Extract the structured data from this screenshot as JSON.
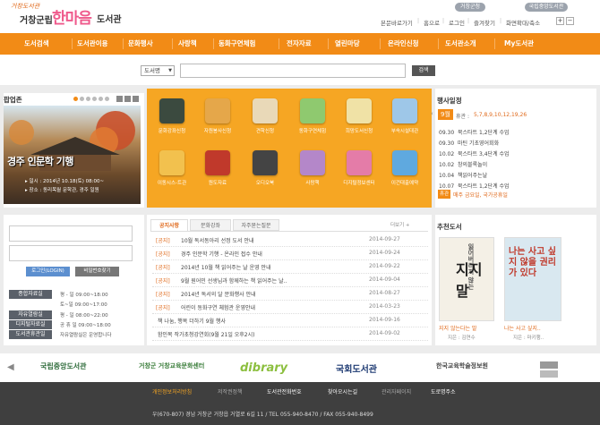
{
  "header": {
    "logo_small": "거창도서관",
    "logo_city": "거창군립",
    "logo_main": "한마음",
    "logo_lib": "도서관",
    "top_pills": [
      "거창군청",
      "국립중앙도서관"
    ],
    "util_links": [
      "본문바로가기",
      "홈으로",
      "로그인",
      "즐겨찾기",
      "화면확대/축소"
    ]
  },
  "nav": {
    "items": [
      "도서검색",
      "도서관이용",
      "문화행사",
      "사랑책",
      "동화구연체험",
      "전자자료",
      "열린마당",
      "온라인신청",
      "도서관소개",
      "My도서관"
    ]
  },
  "search": {
    "select_value": "도서명",
    "input_value": "",
    "button_label": "검색"
  },
  "popup": {
    "title": "팝업존",
    "headline": "경주 인문학 기행",
    "line1": "▸ 일시 : 2014년 10.18(토) 08:00~",
    "line2": "▸ 장소 : 동리목월 문학관, 경주 일원"
  },
  "services": [
    {
      "label": "문화강좌신청",
      "icon": "blackboard-icon",
      "color": "#3b4a3f"
    },
    {
      "label": "자원봉사신청",
      "icon": "books-shelf-icon",
      "color": "#e5a74a"
    },
    {
      "label": "견학신청",
      "icon": "hands-icon",
      "color": "#e9d9b8"
    },
    {
      "label": "동화구연체험",
      "icon": "storybook-icon",
      "color": "#8fc96f"
    },
    {
      "label": "희망도서신청",
      "icon": "notepad-icon",
      "color": "#f0e2a6"
    },
    {
      "label": "부속시설대관",
      "icon": "blocks-icon",
      "color": "#9ec7e8"
    },
    {
      "label": "이동시스-트관",
      "icon": "house-icon",
      "color": "#f2c14e"
    },
    {
      "label": "원도자료",
      "icon": "binders-icon",
      "color": "#c0392b"
    },
    {
      "label": "오디오북",
      "icon": "headphones-icon",
      "color": "#444444"
    },
    {
      "label": "사랑책",
      "icon": "family-icon",
      "color": "#b487c9"
    },
    {
      "label": "디지털정보센터",
      "icon": "cube-icon",
      "color": "#e47ca8"
    },
    {
      "label": "이건대출예약",
      "icon": "globe-icon",
      "color": "#5fa9df"
    }
  ],
  "events": {
    "title": "행사일정",
    "month": "9월",
    "label": "휴관 :",
    "days": "5,7,8,9,10,12,19,26",
    "items": [
      {
        "time": "09.30",
        "text": "북스타트 1,2단계 수업"
      },
      {
        "time": "09.30",
        "text": "마틴 기초영어회화"
      },
      {
        "time": "10.02",
        "text": "북스타트 3,4단계 수업"
      },
      {
        "time": "10.02",
        "text": "창의블록놀이"
      },
      {
        "time": "10.04",
        "text": "책읽어주는날"
      },
      {
        "time": "10.07",
        "text": "북스타트 1,2단계 수업"
      }
    ],
    "closed_badge": "휴관",
    "closed_text": "매주 금요일, 국가공휴일"
  },
  "login": {
    "login_label": "로그인(LOGIN)",
    "signup_label": "비밀번호찾기",
    "hours": [
      {
        "label": "종합자료실",
        "lines": [
          "평 - 일 09:00~18:00",
          "토~일 09:00~17:00"
        ]
      },
      {
        "label": "자유열람실",
        "lines": [
          "평 - 일 08:00~22:00"
        ]
      },
      {
        "label": "디지털자료실",
        "lines": [
          "공 휴 일 09:00~18:00"
        ]
      },
      {
        "label": "도서관휴관일",
        "lines": [
          "자유열람실은 운영합니다"
        ]
      }
    ]
  },
  "notices": {
    "tabs": [
      "공지사항",
      "문화강좌",
      "자주묻는질문"
    ],
    "more": "더보기 +",
    "rows": [
      {
        "cat": "[공지]",
        "title": "10월 독서동아리 선정 도서 안내",
        "date": "2014-09-27"
      },
      {
        "cat": "[공지]",
        "title": "경주 인문학 기행 - 온라인 접수 안내",
        "date": "2014-09-24"
      },
      {
        "cat": "[공지]",
        "title": "2014년 10월 책 읽어주는 날 운영 안내",
        "date": "2014-09-22"
      },
      {
        "cat": "[공지]",
        "title": "9월 원어민 선생님과 함께하는 책 읽어주는 날..",
        "date": "2014-09-04"
      },
      {
        "cat": "[공지]",
        "title": "2014년 독서의 달 문화행사 안내",
        "date": "2014-08-27"
      },
      {
        "cat": "[공지]",
        "title": "어린이 동화구연 체험관 운영안내",
        "date": "2014-03-23"
      },
      {
        "cat": "",
        "title": "책 나눔, 행복 더하기 9월 행사",
        "date": "2014-09-16"
      },
      {
        "cat": "",
        "title": "함인복 작가초청강연회(9월 21일 오후2시)",
        "date": "2014-09-02"
      }
    ]
  },
  "books": {
    "title": "추천도서",
    "book1": {
      "cover": "지지 말",
      "cover_sub": "잃어버리지 않는",
      "caption": "지지 않는다는 말",
      "author": "지은 : 김연수"
    },
    "book2": {
      "cover": "나는 사고 싶지 않을 권리가 있다",
      "caption": "나는 사고 싶지..",
      "author": "지은 : 마키행.."
    }
  },
  "partners": [
    {
      "name": "국립중앙도서관",
      "color": "#2e6b3a"
    },
    {
      "name": "거창군 거창교육문화센터",
      "color": "#3a7d3a"
    },
    {
      "name": "dibrary",
      "color": "#8cbf3f"
    },
    {
      "name": "국회도서관",
      "color": "#1f3b73"
    },
    {
      "name": "한국교육학술정보원",
      "color": "#444444"
    }
  ],
  "footer": {
    "links": [
      "개인정보처리방침",
      "저작권정책",
      "도서관전화번호",
      "찾아오시는길",
      "관리자페이지",
      "도로명주소"
    ],
    "address": "우(670-807) 경남 거창군 거창읍 거열로 6길 11 / TEL 055-940-8470 / FAX 055-940-8499"
  }
}
